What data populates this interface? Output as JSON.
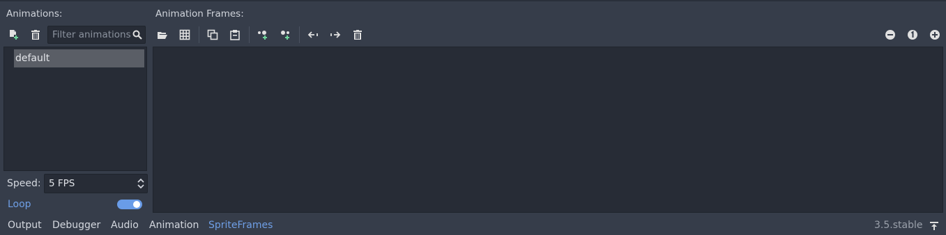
{
  "animations_panel": {
    "title": "Animations:",
    "filter_placeholder": "Filter animations",
    "filter_value": "",
    "items": [
      {
        "label": "default",
        "selected": true
      }
    ],
    "speed_label": "Speed:",
    "speed_value": "5 FPS",
    "loop_label": "Loop",
    "loop_enabled": true
  },
  "frames_panel": {
    "title": "Animation Frames:",
    "toolbar_icons": [
      "open-folder-icon",
      "grid-icon",
      "copy-icon",
      "paste-icon",
      "insert-before-icon",
      "insert-after-icon",
      "move-left-icon",
      "move-right-icon",
      "delete-icon"
    ],
    "zoom_icons": [
      "zoom-out-icon",
      "zoom-reset-icon",
      "zoom-in-icon"
    ]
  },
  "bottom_bar": {
    "tabs": [
      {
        "label": "Output",
        "active": false
      },
      {
        "label": "Debugger",
        "active": false
      },
      {
        "label": "Audio",
        "active": false
      },
      {
        "label": "Animation",
        "active": false
      },
      {
        "label": "SpriteFrames",
        "active": true
      }
    ],
    "version": "3.5.stable"
  },
  "colors": {
    "background": "#363d4a",
    "panel_dark": "#272c36",
    "accent": "#6f9fe6",
    "add_green": "#6ed49a",
    "selected_item": "#5a5e66"
  }
}
